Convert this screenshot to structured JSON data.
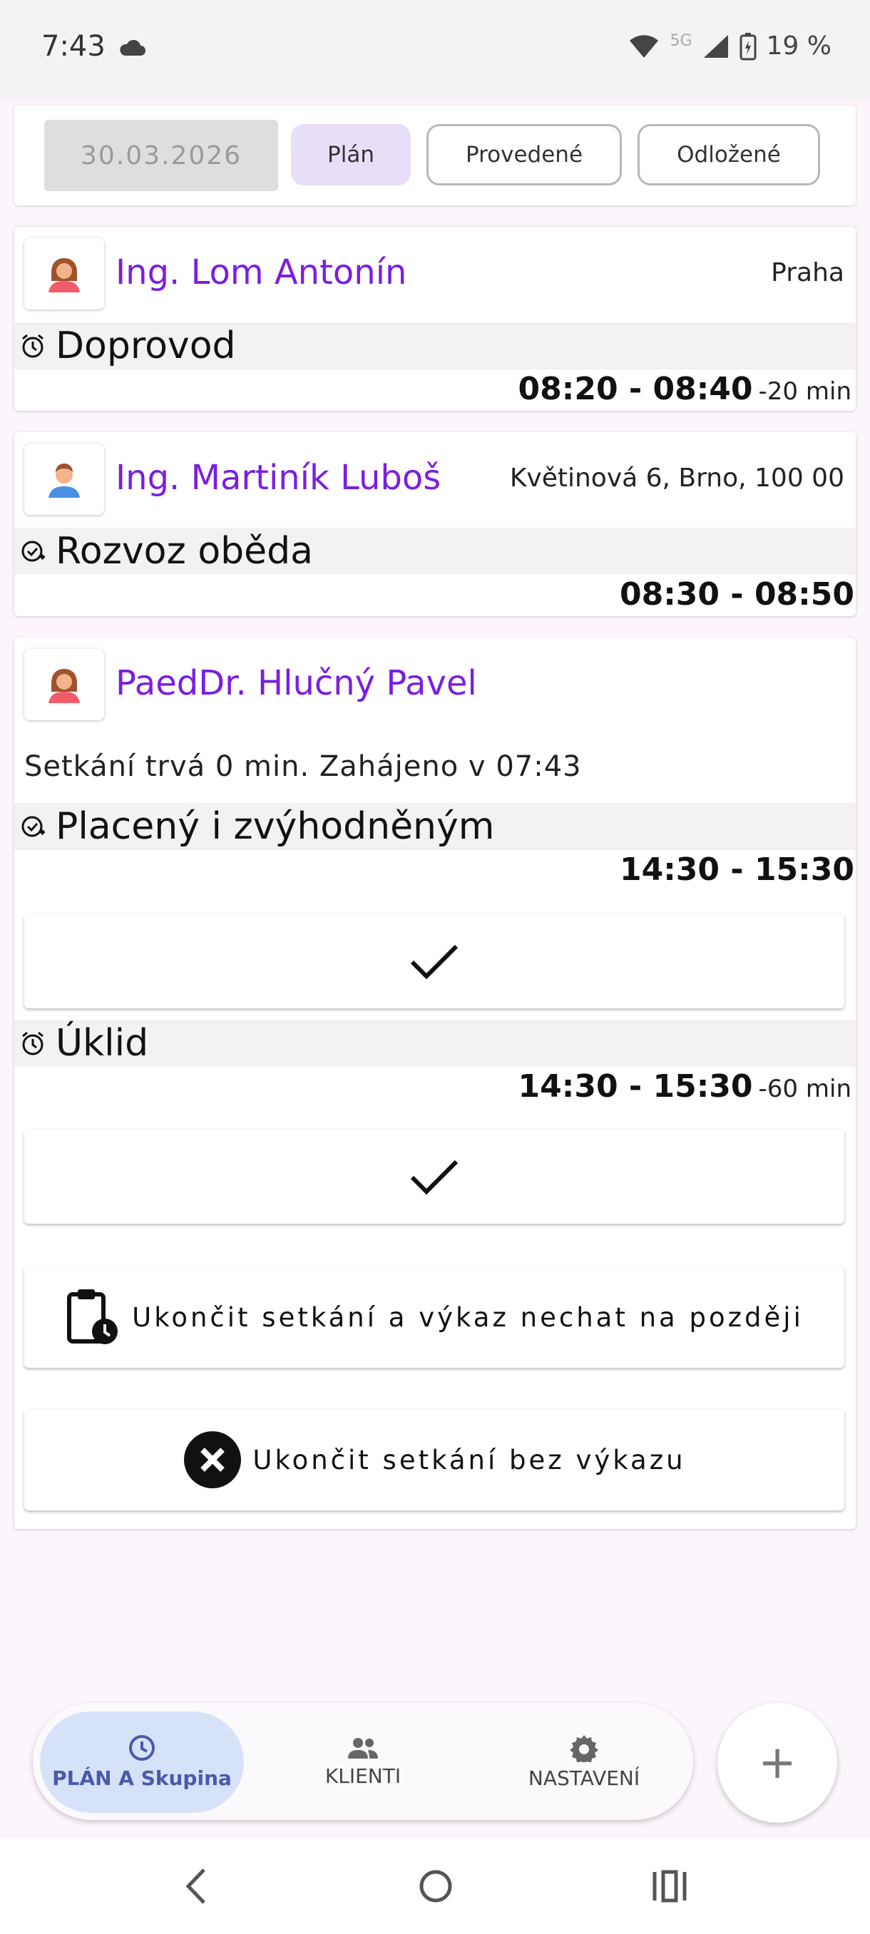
{
  "status_bar": {
    "time": "7:43",
    "network": "5G",
    "battery": "19 %"
  },
  "filter_bar": {
    "date": "30.03.2026",
    "tabs": [
      "Plán",
      "Provedené",
      "Odložené"
    ],
    "active_tab": "Plán"
  },
  "cards": [
    {
      "client_name": "Ing. Lom Antonín",
      "address": "Praha",
      "avatar": "female-avatar-icon",
      "services": [
        {
          "icon": "alarm-clock-icon",
          "name": "Doprovod",
          "time": "08:20 - 08:40",
          "diff": "-20 min"
        }
      ]
    },
    {
      "client_name": "Ing. Martiník Luboš",
      "address": "Květinová 6, Brno, 100 00",
      "avatar": "male-avatar-icon",
      "services": [
        {
          "icon": "calendar-check-icon",
          "name": "Rozvoz oběda",
          "time": "08:30 - 08:50",
          "diff": ""
        }
      ]
    },
    {
      "client_name": "PaedDr. Hlučný Pavel",
      "address": "",
      "avatar": "female-avatar-icon",
      "note": "Setkání trvá 0 min. Zahájeno v 07:43",
      "services": [
        {
          "icon": "calendar-check-icon",
          "name": "Placený i zvýhodněným",
          "time": "14:30 - 15:30",
          "diff": ""
        },
        {
          "icon": "alarm-clock-icon",
          "name": "Úklid",
          "time": "14:30 - 15:30",
          "diff": "-60 min"
        }
      ],
      "actions": {
        "finish_later": "Ukončit setkání a výkaz nechat na později",
        "finish_without": "Ukončit setkání bez výkazu"
      }
    }
  ],
  "bottom_nav": {
    "items": [
      {
        "label": "PLÁN A Skupina",
        "icon": "clock-icon",
        "active": true
      },
      {
        "label": "KLIENTI",
        "icon": "people-icon",
        "active": false
      },
      {
        "label": "NASTAVENÍ",
        "icon": "gear-icon",
        "active": false
      }
    ],
    "fab": "+"
  },
  "colors": {
    "accent": "#7a1fe0",
    "chip_active": "#e8def8",
    "nav_active": "#d6e2f8"
  }
}
